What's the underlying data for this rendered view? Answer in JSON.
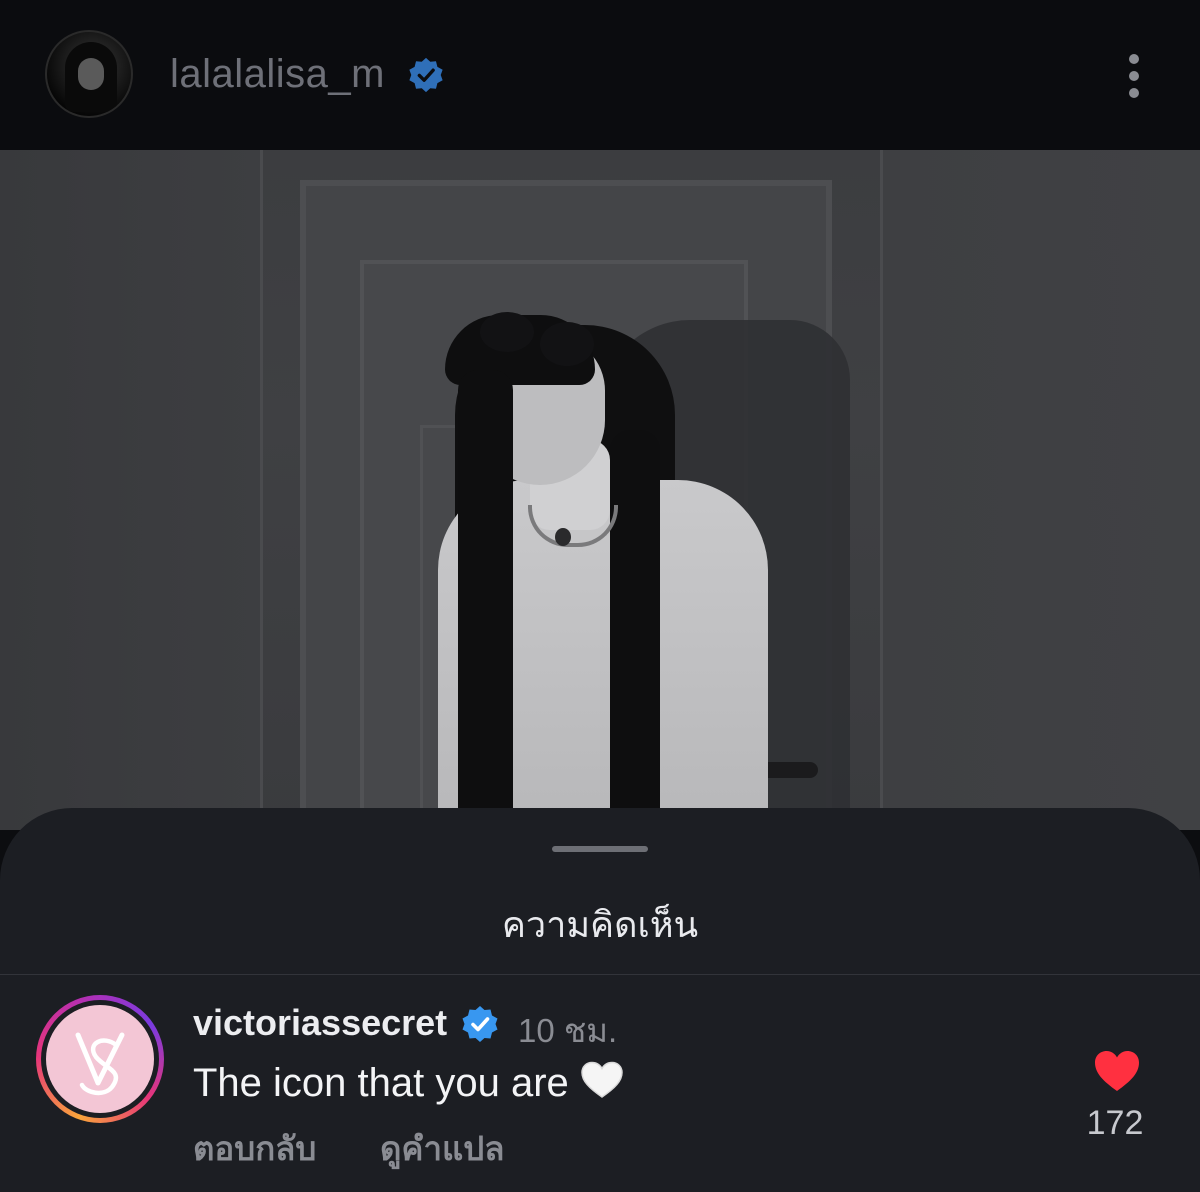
{
  "header": {
    "username": "lalalalisa_m",
    "verified_icon": "verified-badge-icon",
    "more_icon": "more-vertical-icon"
  },
  "post": {
    "image_alt": "black and white photo of a woman in a white sequin gown standing by a door"
  },
  "comments_sheet": {
    "title": "ความคิดเห็น",
    "comment": {
      "username": "victoriassecret",
      "time": "10 ชม.",
      "text": "The icon that you are",
      "emoji": "white-heart-emoji",
      "reply_label": "ตอบกลับ",
      "translate_label": "ดูคำแปล",
      "like_count": "172",
      "liked": true
    }
  },
  "colors": {
    "verified_blue": "#3897f0",
    "like_red": "#ff3040",
    "sheet_bg": "#1c1e23"
  }
}
